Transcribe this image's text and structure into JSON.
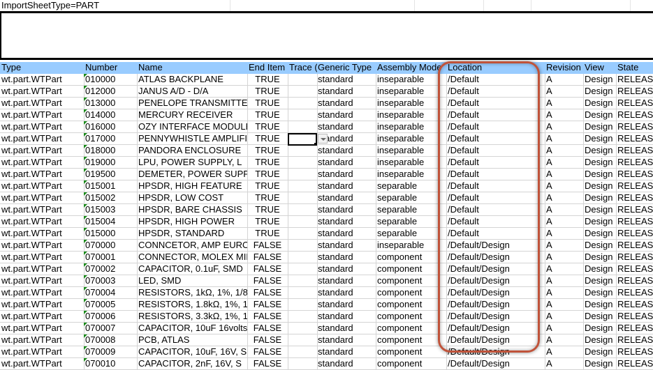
{
  "sheet": {
    "import_type": "ImportSheetType=PART",
    "columns": [
      "Type",
      "Number",
      "Name",
      "End Item",
      "Trace (",
      "Generic Type",
      "Assembly Mode",
      "Location",
      "Revision",
      "View",
      "State"
    ],
    "rows": [
      [
        "wt.part.WTPart",
        "010000",
        "ATLAS BACKPLANE",
        "TRUE",
        "",
        "standard",
        "inseparable",
        "/Default",
        "A",
        "Design",
        "RELEASED"
      ],
      [
        "wt.part.WTPart",
        "012000",
        "JANUS A/D - D/A",
        "TRUE",
        "",
        "standard",
        "inseparable",
        "/Default",
        "A",
        "Design",
        "RELEASED"
      ],
      [
        "wt.part.WTPart",
        "013000",
        "PENELOPE TRANSMITTER",
        "TRUE",
        "",
        "standard",
        "inseparable",
        "/Default",
        "A",
        "Design",
        "RELEASED"
      ],
      [
        "wt.part.WTPart",
        "014000",
        "MERCURY RECEIVER",
        "TRUE",
        "",
        "standard",
        "inseparable",
        "/Default",
        "A",
        "Design",
        "RELEASED"
      ],
      [
        "wt.part.WTPart",
        "016000",
        "OZY INTERFACE MODULE",
        "TRUE",
        "",
        "standard",
        "inseparable",
        "/Default",
        "A",
        "Design",
        "RELEASED"
      ],
      [
        "wt.part.WTPart",
        "017000",
        "PENNYWHISTLE AMPLIFIER",
        "TRUE",
        "",
        "standard",
        "inseparable",
        "/Default",
        "A",
        "Design",
        "RELEASED"
      ],
      [
        "wt.part.WTPart",
        "018000",
        "PANDORA ENCLOSURE",
        "TRUE",
        "",
        "standard",
        "inseparable",
        "/Default",
        "A",
        "Design",
        "RELEASED"
      ],
      [
        "wt.part.WTPart",
        "019000",
        "LPU, POWER SUPPLY, L",
        "TRUE",
        "",
        "standard",
        "inseparable",
        "/Default",
        "A",
        "Design",
        "RELEASED"
      ],
      [
        "wt.part.WTPart",
        "019500",
        "DEMETER, POWER SUPPLY",
        "TRUE",
        "",
        "standard",
        "inseparable",
        "/Default",
        "A",
        "Design",
        "RELEASED"
      ],
      [
        "wt.part.WTPart",
        "015001",
        "HPSDR, HIGH FEATURE",
        "TRUE",
        "",
        "standard",
        "separable",
        "/Default",
        "A",
        "Design",
        "RELEASED"
      ],
      [
        "wt.part.WTPart",
        "015002",
        "HPSDR, LOW COST",
        "TRUE",
        "",
        "standard",
        "separable",
        "/Default",
        "A",
        "Design",
        "RELEASED"
      ],
      [
        "wt.part.WTPart",
        "015003",
        "HPSDR, BARE CHASSIS",
        "TRUE",
        "",
        "standard",
        "separable",
        "/Default",
        "A",
        "Design",
        "RELEASED"
      ],
      [
        "wt.part.WTPart",
        "015004",
        "HPSDR, HIGH POWER",
        "TRUE",
        "",
        "standard",
        "separable",
        "/Default",
        "A",
        "Design",
        "RELEASED"
      ],
      [
        "wt.part.WTPart",
        "015000",
        "HPSDR, STANDARD",
        "TRUE",
        "",
        "standard",
        "separable",
        "/Default",
        "A",
        "Design",
        "RELEASED"
      ],
      [
        "wt.part.WTPart",
        "070000",
        "CONNCETOR,  AMP EURO",
        "FALSE",
        "",
        "standard",
        "inseparable",
        "/Default/Design",
        "A",
        "Design",
        "RELEASED"
      ],
      [
        "wt.part.WTPart",
        "070001",
        "CONNECTOR, MOLEX MINI",
        "FALSE",
        "",
        "standard",
        "component",
        "/Default/Design",
        "A",
        "Design",
        "RELEASED"
      ],
      [
        "wt.part.WTPart",
        "070002",
        "CAPACITOR, 0.1uF, SMD",
        "FALSE",
        "",
        "standard",
        "component",
        "/Default/Design",
        "A",
        "Design",
        "RELEASED"
      ],
      [
        "wt.part.WTPart",
        "070003",
        "LED, SMD",
        "FALSE",
        "",
        "standard",
        "component",
        "/Default/Design",
        "A",
        "Design",
        "RELEASED"
      ],
      [
        "wt.part.WTPart",
        "070004",
        "RESISTORS, 1kΩ, 1%, 1/8",
        "FALSE",
        "",
        "standard",
        "component",
        "/Default/Design",
        "A",
        "Design",
        "RELEASED"
      ],
      [
        "wt.part.WTPart",
        "070005",
        "RESISTORS, 1.8kΩ, 1%, 1",
        "FALSE",
        "",
        "standard",
        "component",
        "/Default/Design",
        "A",
        "Design",
        "RELEASED"
      ],
      [
        "wt.part.WTPart",
        "070006",
        "RESISTORS, 3.3kΩ, 1%, 1",
        "FALSE",
        "",
        "standard",
        "component",
        "/Default/Design",
        "A",
        "Design",
        "RELEASED"
      ],
      [
        "wt.part.WTPart",
        "070007",
        "CAPACITOR, 10uF 16volts",
        "FALSE",
        "",
        "standard",
        "component",
        "/Default/Design",
        "A",
        "Design",
        "RELEASED"
      ],
      [
        "wt.part.WTPart",
        "070008",
        "PCB, ATLAS",
        "FALSE",
        "",
        "standard",
        "component",
        "/Default/Design",
        "A",
        "Design",
        "RELEASED"
      ],
      [
        "wt.part.WTPart",
        "070009",
        "CAPACITOR,  10uF, 16V, S",
        "FALSE",
        "",
        "standard",
        "component",
        "/Default/Design",
        "A",
        "Design",
        "RELEASED"
      ],
      [
        "wt.part.WTPart",
        "070010",
        "CAPACITOR,  2nF, 16V, S",
        "FALSE",
        "",
        "standard",
        "component",
        "/Default/Design",
        "A",
        "Design",
        "RELEASED"
      ]
    ],
    "selected_cell": {
      "column": "Trace (",
      "row_number": "017000"
    },
    "highlighted_column": "Location",
    "colors": {
      "header_bg": "#99ccff",
      "gridline": "#d4d4d4",
      "highlight_border": "#c0533a",
      "number_text_marker": "#1a8a1a"
    }
  }
}
